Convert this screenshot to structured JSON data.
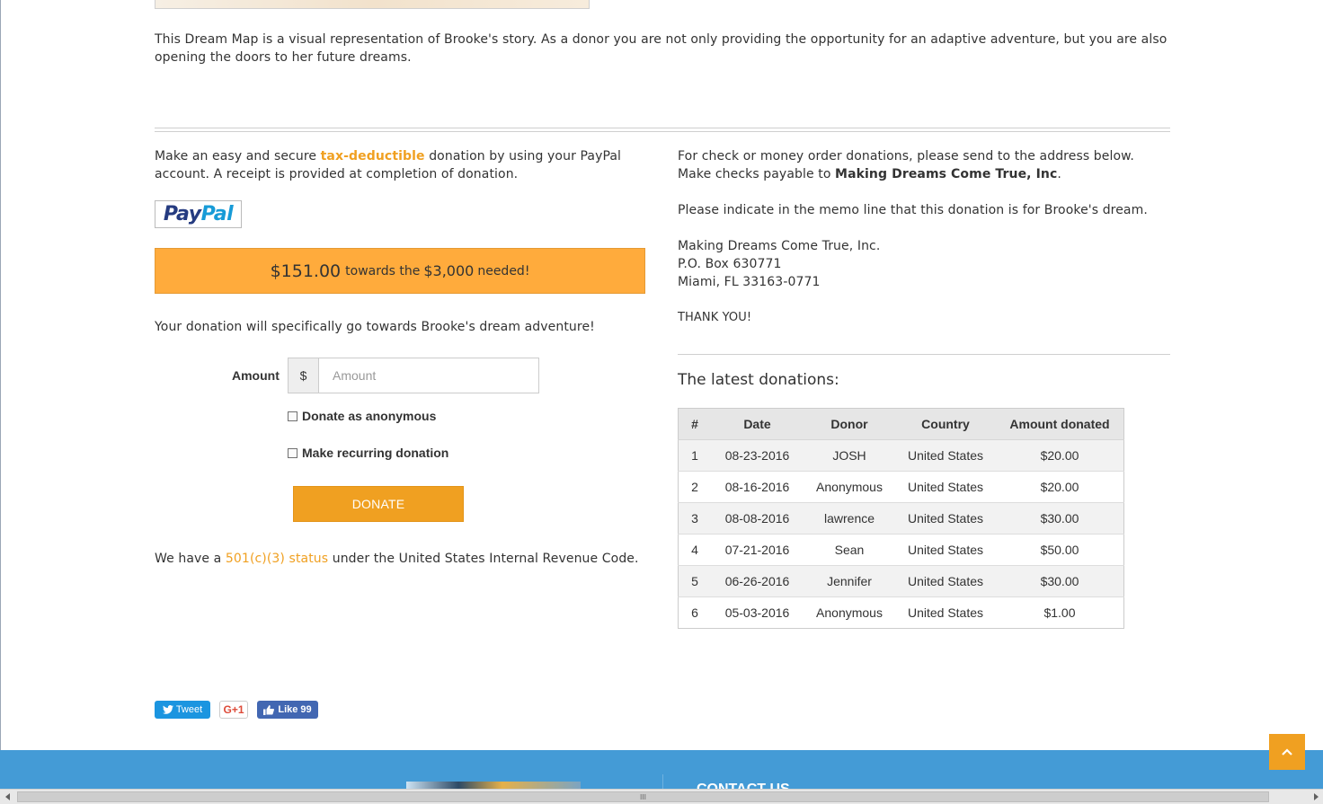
{
  "intro": {
    "text": "This Dream Map is a visual representation of Brooke's story. As a donor you are not only providing the opportunity for an adaptive adventure, but you are also opening the doors to her future dreams."
  },
  "paypal_section": {
    "text_before": "Make an easy and secure ",
    "highlight": "tax-deductible",
    "text_after": " donation by using your PayPal account. A receipt is provided at completion of donation.",
    "logo_part1": "Pay",
    "logo_part2": "Pal"
  },
  "progress": {
    "raised": "$151.00",
    "middle": "towards the",
    "goal": "$3,000",
    "suffix": "needed!"
  },
  "dream_note": "Your donation will specifically go towards Brooke's dream adventure!",
  "form": {
    "amount_label": "Amount",
    "currency_symbol": "$",
    "amount_placeholder": "Amount",
    "amount_value": "",
    "anonymous_label": "Donate as anonymous",
    "recurring_label": "Make recurring donation",
    "donate_button": "Donate"
  },
  "status_note": {
    "before": "We have a ",
    "link": "501(c)(3) status",
    "after": " under the United States Internal Revenue Code."
  },
  "check_section": {
    "line1": "For check or money order donations, please send to the address below.",
    "line2_before": "Make checks payable to ",
    "line2_bold": "Making Dreams Come True, Inc",
    "line2_after": ".",
    "memo": "Please indicate in the memo line that this donation is for Brooke's dream.",
    "address1": "Making Dreams Come True, Inc.",
    "address2": "P.O. Box 630771",
    "address3": "Miami, FL 33163-0771",
    "thanks": "THANK YOU!"
  },
  "donations": {
    "heading": "The latest donations:",
    "columns": [
      "#",
      "Date",
      "Donor",
      "Country",
      "Amount donated"
    ],
    "rows": [
      [
        "1",
        "08-23-2016",
        "JOSH",
        "United States",
        "$20.00"
      ],
      [
        "2",
        "08-16-2016",
        "Anonymous",
        "United States",
        "$20.00"
      ],
      [
        "3",
        "08-08-2016",
        "lawrence",
        "United States",
        "$30.00"
      ],
      [
        "4",
        "07-21-2016",
        "Sean",
        "United States",
        "$50.00"
      ],
      [
        "5",
        "06-26-2016",
        "Jennifer",
        "United States",
        "$30.00"
      ],
      [
        "6",
        "05-03-2016",
        "Anonymous",
        "United States",
        "$1.00"
      ]
    ]
  },
  "social": {
    "tweet": "Tweet",
    "gplus": "G+1",
    "like": "Like 99"
  },
  "footer": {
    "heading": "CONTACT US"
  },
  "scrollbar": {
    "grip": "III"
  },
  "colors": {
    "accent": "#f0a021",
    "progress_bar": "#ffab3c",
    "footer": "#449bd6"
  }
}
